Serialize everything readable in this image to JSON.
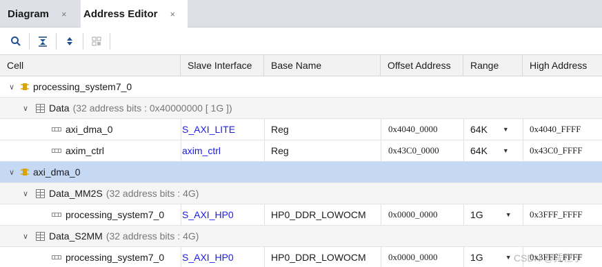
{
  "tabs": [
    {
      "label": "Diagram",
      "close": "×"
    },
    {
      "label": "Address Editor",
      "close": "×"
    }
  ],
  "toolbar": {
    "buttons": [
      "search-icon",
      "collapse-all-icon",
      "expand-all-icon",
      "auto-assign-icon"
    ]
  },
  "columns": [
    "Cell",
    "Slave Interface",
    "Base Name",
    "Offset Address",
    "Range",
    "High Address"
  ],
  "rows": [
    {
      "level": 0,
      "cell": "processing_system7_0"
    },
    {
      "level": 1,
      "cell": "Data",
      "note": "(32 address bits : 0x40000000 [ 1G ])"
    },
    {
      "level": 2,
      "cell": "axi_dma_0",
      "slave": "S_AXI_LITE",
      "base": "Reg",
      "offset": "0x4040_0000",
      "range": "64K",
      "high": "0x4040_FFFF"
    },
    {
      "level": 2,
      "cell": "axim_ctrl",
      "slave": "axim_ctrl",
      "base": "Reg",
      "offset": "0x43C0_0000",
      "range": "64K",
      "high": "0x43C0_FFFF"
    },
    {
      "level": 0,
      "cell": "axi_dma_0"
    },
    {
      "level": 1,
      "cell": "Data_MM2S",
      "note": "(32 address bits : 4G)"
    },
    {
      "level": 2,
      "cell": "processing_system7_0",
      "slave": "S_AXI_HP0",
      "base": "HP0_DDR_LOWOCM",
      "offset": "0x0000_0000",
      "range": "1G",
      "high": "0x3FFF_FFFF"
    },
    {
      "level": 1,
      "cell": "Data_S2MM",
      "note": "(32 address bits : 4G)"
    },
    {
      "level": 2,
      "cell": "processing_system7_0",
      "slave": "S_AXI_HP0",
      "base": "HP0_DDR_LOWOCM",
      "offset": "0x0000_0000",
      "range": "1G",
      "high": "0x3FFF_FFFF"
    }
  ],
  "watermark": "CSDN @凭栏了",
  "colors": {
    "selected_row": "#c5d9f5",
    "link_text": "#1a1ae6",
    "ip_icon": "#d9a400"
  }
}
